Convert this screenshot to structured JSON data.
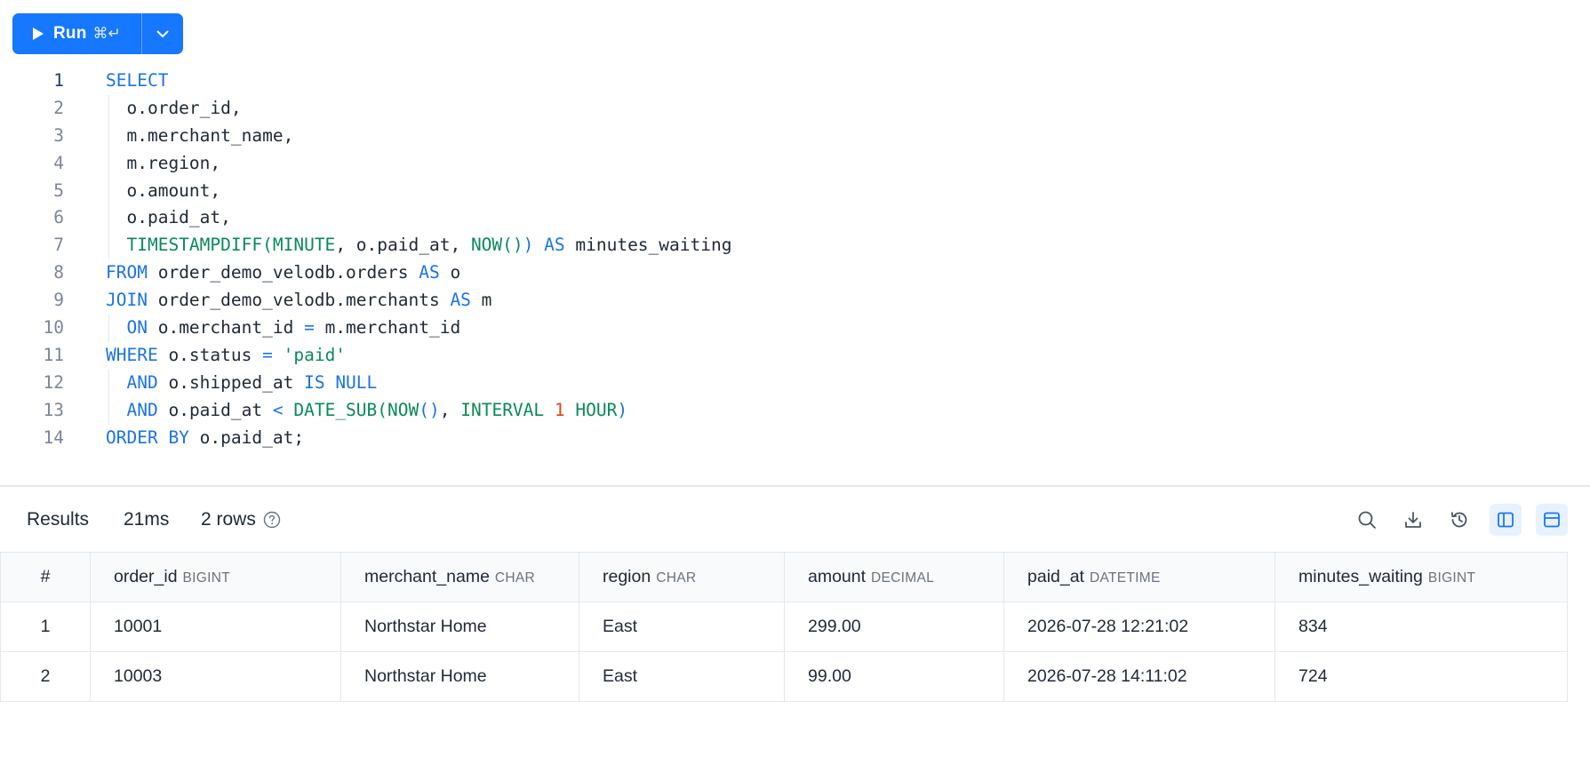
{
  "toolbar": {
    "run_label": "Run",
    "run_shortcut": "⌘↵",
    "run_icon": "play-icon",
    "dropdown_icon": "chevron-down-icon",
    "accent_color": "#1677ff"
  },
  "editor": {
    "lines": [
      {
        "num": "1",
        "tokens": [
          [
            "kw",
            "SELECT"
          ]
        ]
      },
      {
        "num": "2",
        "tokens": [
          [
            "id",
            "  o.order_id,"
          ]
        ]
      },
      {
        "num": "3",
        "tokens": [
          [
            "id",
            "  m.merchant_name,"
          ]
        ]
      },
      {
        "num": "4",
        "tokens": [
          [
            "id",
            "  m.region,"
          ]
        ]
      },
      {
        "num": "5",
        "tokens": [
          [
            "id",
            "  o.amount,"
          ]
        ]
      },
      {
        "num": "6",
        "tokens": [
          [
            "id",
            "  o.paid_at,"
          ]
        ]
      },
      {
        "num": "7",
        "tokens": [
          [
            "id",
            "  "
          ],
          [
            "fn",
            "TIMESTAMPDIFF("
          ],
          [
            "fn",
            "MINUTE"
          ],
          [
            "id",
            ", o.paid_at, "
          ],
          [
            "fn",
            "NOW()"
          ],
          [
            "kw",
            ")"
          ],
          [
            "id",
            " "
          ],
          [
            "kw",
            "AS"
          ],
          [
            "id",
            " minutes_waiting"
          ]
        ]
      },
      {
        "num": "8",
        "tokens": [
          [
            "kw",
            "FROM"
          ],
          [
            "id",
            " order_demo_velodb.orders "
          ],
          [
            "kw",
            "AS"
          ],
          [
            "id",
            " o"
          ]
        ]
      },
      {
        "num": "9",
        "tokens": [
          [
            "kw",
            "JOIN"
          ],
          [
            "id",
            " order_demo_velodb.merchants "
          ],
          [
            "kw",
            "AS"
          ],
          [
            "id",
            " m"
          ]
        ]
      },
      {
        "num": "10",
        "tokens": [
          [
            "id",
            "  "
          ],
          [
            "kw",
            "ON"
          ],
          [
            "id",
            " o.merchant_id "
          ],
          [
            "op",
            "="
          ],
          [
            "id",
            " m.merchant_id"
          ]
        ]
      },
      {
        "num": "11",
        "tokens": [
          [
            "kw",
            "WHERE"
          ],
          [
            "id",
            " o.status "
          ],
          [
            "op",
            "="
          ],
          [
            "id",
            " "
          ],
          [
            "str",
            "'paid'"
          ]
        ]
      },
      {
        "num": "12",
        "tokens": [
          [
            "id",
            "  "
          ],
          [
            "kw",
            "AND"
          ],
          [
            "id",
            " o.shipped_at "
          ],
          [
            "kw",
            "IS NULL"
          ]
        ]
      },
      {
        "num": "13",
        "tokens": [
          [
            "id",
            "  "
          ],
          [
            "kw",
            "AND"
          ],
          [
            "id",
            " o.paid_at "
          ],
          [
            "op",
            "<"
          ],
          [
            "id",
            " "
          ],
          [
            "fn",
            "DATE_SUB("
          ],
          [
            "fn",
            "NOW"
          ],
          [
            "kw",
            "()"
          ],
          [
            "id",
            ", "
          ],
          [
            "fn",
            "INTERVAL"
          ],
          [
            "id",
            " "
          ],
          [
            "num",
            "1"
          ],
          [
            "id",
            " "
          ],
          [
            "fn",
            "HOUR"
          ],
          [
            "kw",
            ")"
          ]
        ]
      },
      {
        "num": "14",
        "tokens": [
          [
            "kw",
            "ORDER BY"
          ],
          [
            "id",
            " o.paid_at;"
          ]
        ]
      }
    ],
    "active_line": "1"
  },
  "results": {
    "title": "Results",
    "time": "21ms",
    "rows_label": "2 rows",
    "icons": [
      "search-icon",
      "download-icon",
      "history-icon",
      "columns-layout-icon",
      "rows-layout-icon"
    ]
  },
  "table": {
    "columns": [
      {
        "name": "#",
        "type": ""
      },
      {
        "name": "order_id",
        "type": "BIGINT"
      },
      {
        "name": "merchant_name",
        "type": "CHAR"
      },
      {
        "name": "region",
        "type": "CHAR"
      },
      {
        "name": "amount",
        "type": "DECIMAL"
      },
      {
        "name": "paid_at",
        "type": "DATETIME"
      },
      {
        "name": "minutes_waiting",
        "type": "BIGINT"
      }
    ],
    "rows": [
      [
        "1",
        "10001",
        "Northstar Home",
        "East",
        "299.00",
        "2026-07-28 12:21:02",
        "834"
      ],
      [
        "2",
        "10003",
        "Northstar Home",
        "East",
        "99.00",
        "2026-07-28 14:11:02",
        "724"
      ]
    ]
  }
}
